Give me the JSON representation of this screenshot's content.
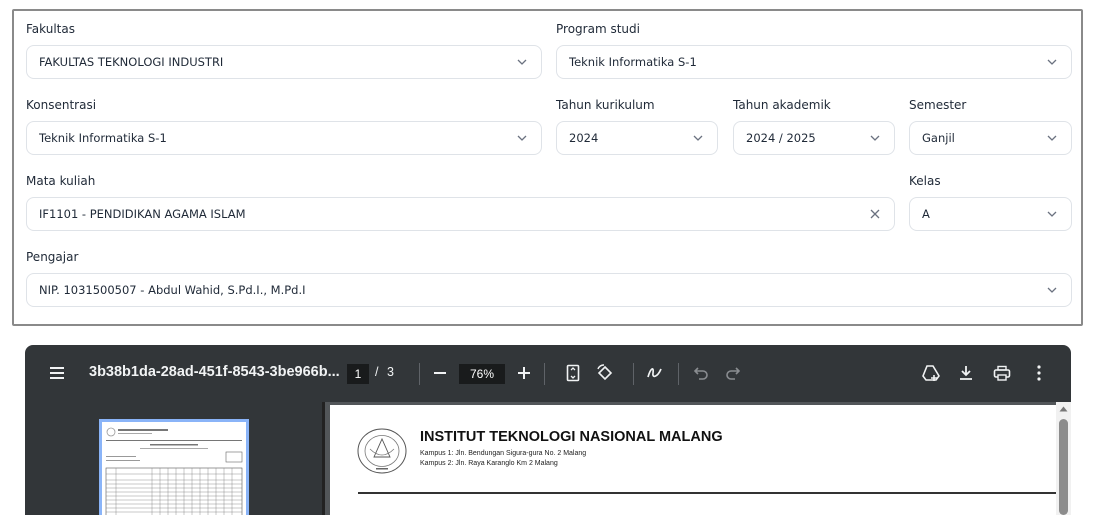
{
  "form": {
    "fakultas": {
      "label": "Fakultas",
      "value": "FAKULTAS TEKNOLOGI INDUSTRI"
    },
    "program_studi": {
      "label": "Program studi",
      "value": "Teknik Informatika S-1"
    },
    "konsentrasi": {
      "label": "Konsentrasi",
      "value": "Teknik Informatika S-1"
    },
    "tahun_kurikulum": {
      "label": "Tahun kurikulum",
      "value": "2024"
    },
    "tahun_akademik": {
      "label": "Tahun akademik",
      "value": "2024 / 2025"
    },
    "semester": {
      "label": "Semester",
      "value": "Ganjil"
    },
    "mata_kuliah": {
      "label": "Mata kuliah",
      "value": "IF1101 - PENDIDIKAN AGAMA ISLAM"
    },
    "kelas": {
      "label": "Kelas",
      "value": "A"
    },
    "pengajar": {
      "label": "Pengajar",
      "value": "NIP. 1031500507 - Abdul Wahid, S.Pd.I., M.Pd.I"
    }
  },
  "viewer": {
    "title": "3b38b1da-28ad-451f-8543-3be966b...",
    "current_page": "1",
    "page_separator": "/",
    "total_pages": "3",
    "zoom": "76%",
    "icons": [
      "menu-icon",
      "zoom-out-icon",
      "zoom-in-icon",
      "fit-page-icon",
      "rotate-icon",
      "annotate-icon",
      "undo-icon",
      "redo-icon",
      "drive-icon",
      "download-icon",
      "print-icon",
      "more-icon"
    ]
  },
  "document": {
    "institution": "INSTITUT TEKNOLOGI NASIONAL MALANG",
    "campus1": "Kampus 1: Jln. Bendungan Sigura-gura No. 2 Malang",
    "campus2": "Kampus 2: Jln. Raya Karanglo Km 2 Malang"
  }
}
